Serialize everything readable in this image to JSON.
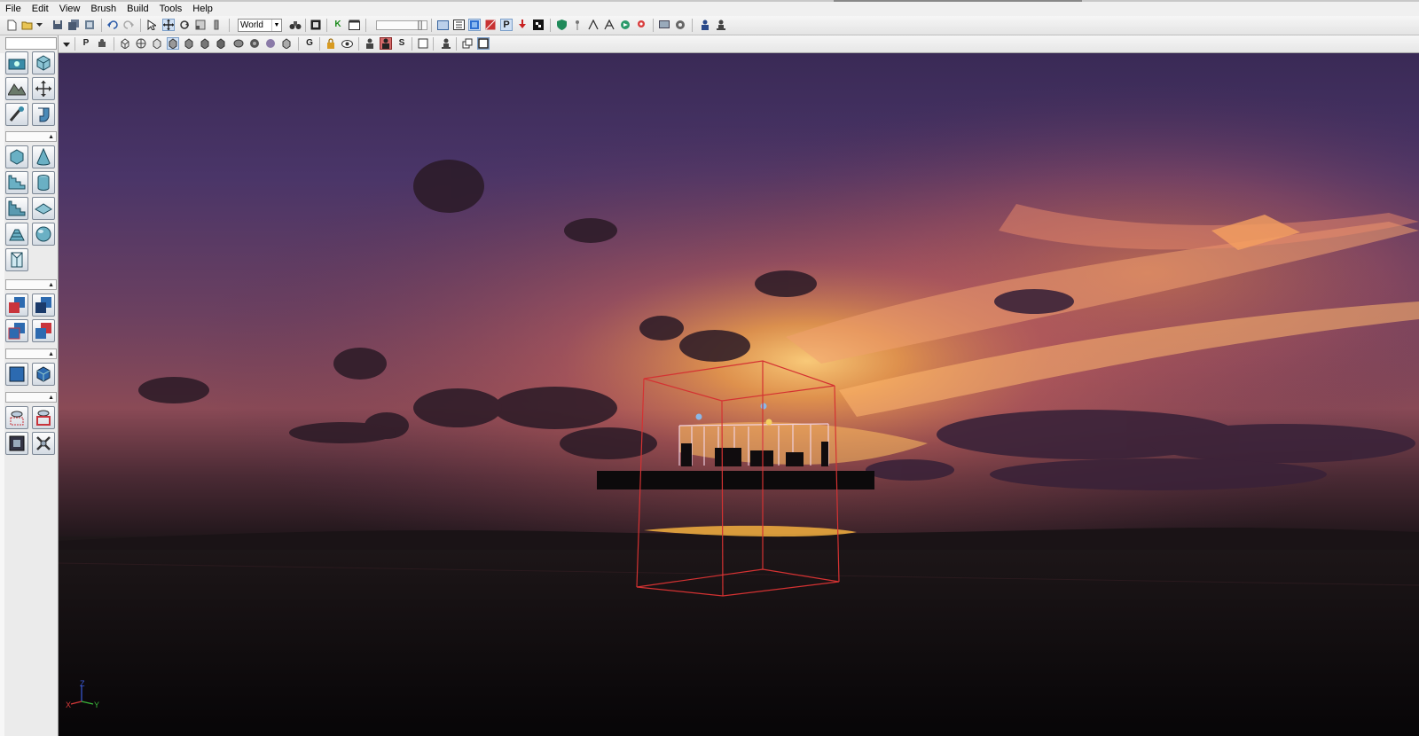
{
  "menu": [
    "File",
    "Edit",
    "View",
    "Brush",
    "Build",
    "Tools",
    "Help"
  ],
  "toolbar": {
    "coordinate_system": "World",
    "grid_slider_value": 0.9,
    "toolbar2_letters": {
      "perspective": "P",
      "gizmo": "G",
      "snap": "S"
    }
  },
  "viewport": {
    "axis_labels": {
      "z": "Z",
      "x": "X",
      "y": "Y"
    },
    "colors": {
      "selection_box": "#d43232",
      "sky_glow": "#f5a34a"
    }
  }
}
